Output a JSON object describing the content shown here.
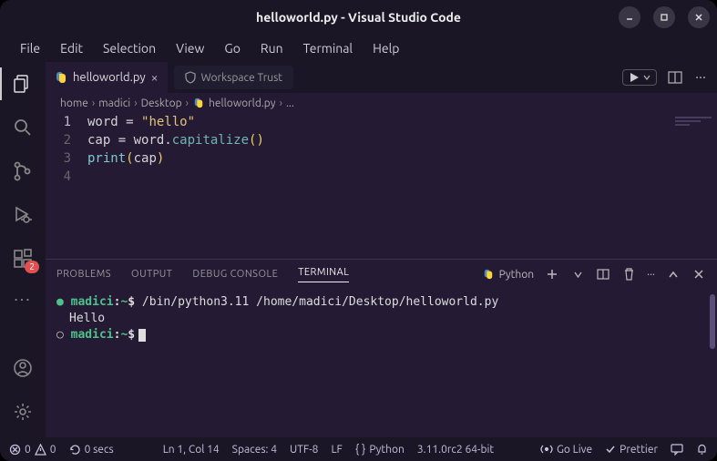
{
  "window": {
    "title": "helloworld.py - Visual Studio Code"
  },
  "menu": [
    "File",
    "Edit",
    "Selection",
    "View",
    "Go",
    "Run",
    "Terminal",
    "Help"
  ],
  "activity": {
    "ext_badge": "2"
  },
  "tabs": {
    "file": "helloworld.py",
    "trust": "Workspace Trust"
  },
  "breadcrumb": {
    "b0": "home",
    "b1": "madici",
    "b2": "Desktop",
    "b3": "helloworld.py",
    "b4": "..."
  },
  "code": {
    "l1": {
      "n": "1",
      "a": "word ",
      "b": "= ",
      "c": "\"hello\""
    },
    "l2": {
      "n": "2",
      "a": "cap ",
      "b": "= ",
      "c": "word",
      "d": ".",
      "e": "capitalize",
      "f": "(",
      "g": ")"
    },
    "l3": {
      "n": "3",
      "a": "print",
      "b": "(",
      "c": "cap",
      "d": ")"
    },
    "l4": {
      "n": "4"
    }
  },
  "panel": {
    "tabs": {
      "problems": "PROBLEMS",
      "output": "OUTPUT",
      "debug": "DEBUG CONSOLE",
      "terminal": "TERMINAL"
    },
    "shell_label": "Python"
  },
  "terminal": {
    "user": "madici",
    "sep": ":",
    "path": "~",
    "prompt": "$",
    "cmd": " /bin/python3.11 /home/madici/Desktop/helloworld.py",
    "out": "Hello"
  },
  "status": {
    "errors": "0",
    "warnings": "0",
    "time": "0 secs",
    "cursor": "Ln 1, Col 14",
    "spaces": "Spaces: 4",
    "encoding": "UTF-8",
    "eol": "LF",
    "lang": "Python",
    "interpreter": "3.11.0rc2 64-bit",
    "golive": "Go Live",
    "prettier": "Prettier"
  }
}
